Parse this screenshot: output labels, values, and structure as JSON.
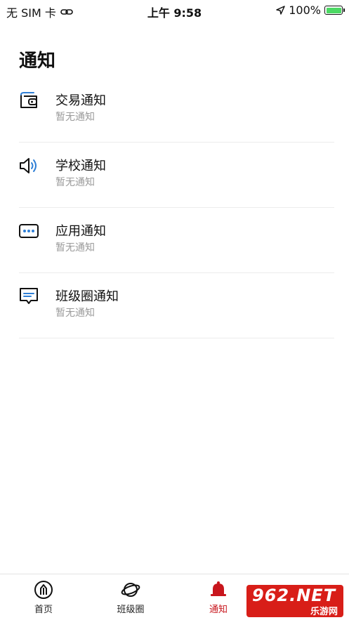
{
  "status_bar": {
    "carrier": "无 SIM 卡",
    "time": "上午 9:58",
    "battery": "100%",
    "battery_level": 1.0
  },
  "page": {
    "title": "通知"
  },
  "notifications": [
    {
      "title": "交易通知",
      "subtitle": "暂无通知",
      "icon": "wallet-icon"
    },
    {
      "title": "学校通知",
      "subtitle": "暂无通知",
      "icon": "speaker-icon"
    },
    {
      "title": "应用通知",
      "subtitle": "暂无通知",
      "icon": "dots-icon"
    },
    {
      "title": "班级圈通知",
      "subtitle": "暂无通知",
      "icon": "message-icon"
    }
  ],
  "tabs": [
    {
      "label": "首页",
      "icon": "home-icon"
    },
    {
      "label": "班级圈",
      "icon": "planet-icon"
    },
    {
      "label": "通知",
      "icon": "bell-icon",
      "active": true
    }
  ],
  "watermark": {
    "brand": "962.NET",
    "sub": "乐游网"
  },
  "colors": {
    "accent": "#c8161d",
    "icon_blue": "#2f7fd6",
    "text_primary": "#111111",
    "text_secondary": "#9a9a9a"
  }
}
